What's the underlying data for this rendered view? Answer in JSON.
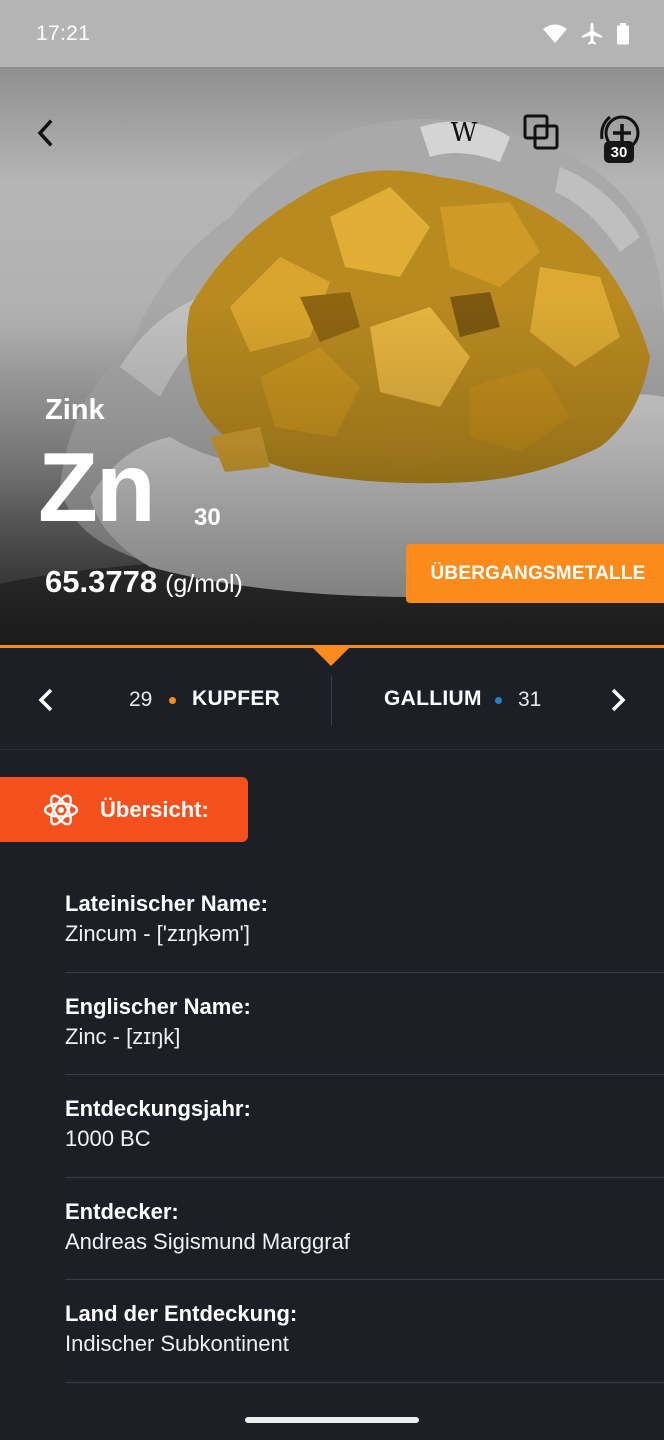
{
  "status_bar": {
    "time": "17:21",
    "icons": [
      "wifi-icon",
      "airplane-icon",
      "battery-icon"
    ]
  },
  "toolbar": {
    "back_icon": "back-arrow-icon",
    "wiki_label": "W",
    "compare_icon": "compare-icon",
    "add_icon": "add-circle-icon",
    "add_badge": "30"
  },
  "element": {
    "name": "Zink",
    "symbol": "Zn",
    "atomic_number": "30",
    "atomic_mass": "65.3778",
    "mass_unit": "(g/mol)",
    "category": "ÜBERGANGSMETALLE"
  },
  "navigation": {
    "prev": {
      "number": "29",
      "name": "KUPFER"
    },
    "next": {
      "name": "GALLIUM",
      "number": "31"
    }
  },
  "section": {
    "icon": "atom-icon",
    "label": "Übersicht:"
  },
  "details": [
    {
      "label": "Lateinischer Name:",
      "value": "Zincum - ['zɪŋkəm']"
    },
    {
      "label": "Englischer Name:",
      "value": "Zinc - [zɪŋk]"
    },
    {
      "label": "Entdeckungsjahr:",
      "value": "1000 BC"
    },
    {
      "label": "Entdecker:",
      "value": "Andreas Sigismund Marggraf"
    },
    {
      "label": "Land der Entdeckung:",
      "value": "Indischer Subkontinent"
    }
  ],
  "colors": {
    "accent": "#fb8c1b",
    "section_tab": "#f4511e",
    "background": "#1d1f27",
    "next_dot": "#1e83c7"
  }
}
